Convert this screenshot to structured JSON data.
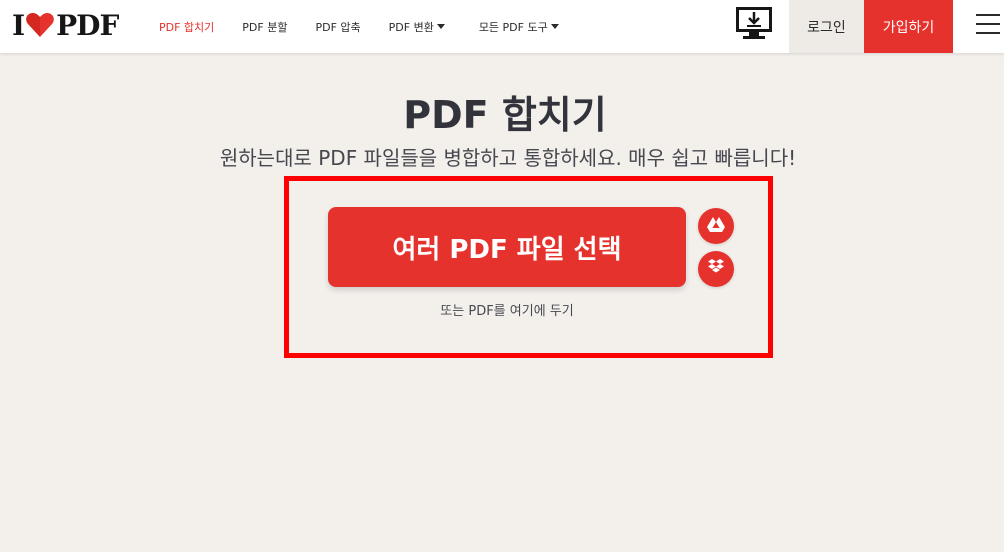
{
  "header": {
    "logo": {
      "left": "I",
      "right": "PDF",
      "heart_icon": "heart-icon"
    },
    "nav": [
      {
        "label": "PDF 합치기",
        "active": true
      },
      {
        "label": "PDF 분할",
        "active": false
      },
      {
        "label": "PDF 압축",
        "active": false
      },
      {
        "label": "PDF 변환",
        "active": false,
        "dropdown": true
      },
      {
        "label": "모든 PDF 도구",
        "active": false,
        "dropdown": true
      }
    ],
    "desktop_icon": "desktop-download-icon",
    "login_label": "로그인",
    "signup_label": "가입하기",
    "menu_icon": "hamburger-menu-icon"
  },
  "main": {
    "title": "PDF 합치기",
    "subtitle": "원하는대로 PDF 파일들을 병합하고 통합하세요. 매우 쉽고 빠릅니다!",
    "select_button_label": "여러 PDF 파일 선택",
    "google_drive_icon": "google-drive-icon",
    "dropbox_icon": "dropbox-icon",
    "drop_hint": "또는 PDF를 여기에 두기"
  },
  "colors": {
    "accent": "#e5322d",
    "background": "#f3f0ec",
    "highlight_border": "#ff0000",
    "text_dark": "#33333b"
  }
}
